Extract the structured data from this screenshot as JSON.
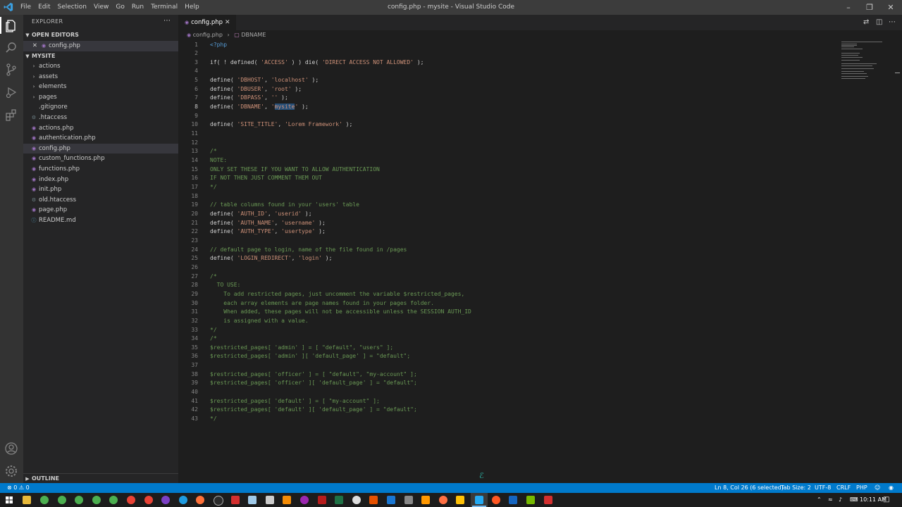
{
  "window": {
    "title": "config.php - mysite - Visual Studio Code",
    "menu": [
      "File",
      "Edit",
      "Selection",
      "View",
      "Go",
      "Run",
      "Terminal",
      "Help"
    ]
  },
  "sidebar": {
    "title": "EXPLORER",
    "open_editors_label": "OPEN EDITORS",
    "open_editors": [
      {
        "name": "config.php"
      }
    ],
    "folder_label": "MYSITE",
    "items": [
      {
        "name": "actions",
        "kind": "folder"
      },
      {
        "name": "assets",
        "kind": "folder"
      },
      {
        "name": "elements",
        "kind": "folder"
      },
      {
        "name": "pages",
        "kind": "folder"
      },
      {
        "name": ".gitignore",
        "kind": "file"
      },
      {
        "name": ".htaccess",
        "kind": "gear"
      },
      {
        "name": "actions.php",
        "kind": "php"
      },
      {
        "name": "authentication.php",
        "kind": "php"
      },
      {
        "name": "config.php",
        "kind": "php",
        "selected": true
      },
      {
        "name": "custom_functions.php",
        "kind": "php"
      },
      {
        "name": "functions.php",
        "kind": "php"
      },
      {
        "name": "index.php",
        "kind": "php"
      },
      {
        "name": "init.php",
        "kind": "php"
      },
      {
        "name": "old.htaccess",
        "kind": "gear"
      },
      {
        "name": "page.php",
        "kind": "php"
      },
      {
        "name": "README.md",
        "kind": "info"
      }
    ],
    "outline_label": "OUTLINE"
  },
  "editor": {
    "tab_label": "config.php",
    "breadcrumb": [
      "config.php",
      "DBNAME"
    ],
    "active_line": 8,
    "lines": [
      [
        [
          "<?php",
          "kw"
        ]
      ],
      [],
      [
        [
          "if( ! defined( ",
          "default"
        ],
        [
          "'ACCESS'",
          "str"
        ],
        [
          " ) ) die( ",
          "default"
        ],
        [
          "'DIRECT ACCESS NOT ALLOWED'",
          "str"
        ],
        [
          " );",
          "default"
        ]
      ],
      [],
      [
        [
          "define( ",
          "default"
        ],
        [
          "'DBHOST'",
          "str"
        ],
        [
          ", ",
          "default"
        ],
        [
          "'localhost'",
          "str"
        ],
        [
          " );",
          "default"
        ]
      ],
      [
        [
          "define( ",
          "default"
        ],
        [
          "'DBUSER'",
          "str"
        ],
        [
          ", ",
          "default"
        ],
        [
          "'root'",
          "str"
        ],
        [
          " );",
          "default"
        ]
      ],
      [
        [
          "define( ",
          "default"
        ],
        [
          "'DBPASS'",
          "str"
        ],
        [
          ", ",
          "default"
        ],
        [
          "''",
          "str"
        ],
        [
          " );",
          "default"
        ]
      ],
      [
        [
          "define( ",
          "default"
        ],
        [
          "'DBNAME'",
          "str"
        ],
        [
          ", ",
          "default"
        ],
        [
          "'",
          "str"
        ],
        [
          "mysite",
          "hl"
        ],
        [
          "'",
          "str"
        ],
        [
          " );",
          "default"
        ]
      ],
      [],
      [
        [
          "define( ",
          "default"
        ],
        [
          "'SITE_TITLE'",
          "str"
        ],
        [
          ", ",
          "default"
        ],
        [
          "'Lorem Framework'",
          "str"
        ],
        [
          " );",
          "default"
        ]
      ],
      [],
      [],
      [
        [
          "/*",
          "com"
        ]
      ],
      [
        [
          "NOTE:",
          "com"
        ]
      ],
      [
        [
          "ONLY SET THESE IF YOU WANT TO ALLOW AUTHENTICATION",
          "com"
        ]
      ],
      [
        [
          "IF NOT THEN JUST COMMENT THEM OUT",
          "com"
        ]
      ],
      [
        [
          "*/",
          "com"
        ]
      ],
      [],
      [
        [
          "// table columns found in your 'users' table",
          "com"
        ]
      ],
      [
        [
          "define( ",
          "default"
        ],
        [
          "'AUTH_ID'",
          "str"
        ],
        [
          ", ",
          "default"
        ],
        [
          "'userid'",
          "str"
        ],
        [
          " );",
          "default"
        ]
      ],
      [
        [
          "define( ",
          "default"
        ],
        [
          "'AUTH_NAME'",
          "str"
        ],
        [
          ", ",
          "default"
        ],
        [
          "'username'",
          "str"
        ],
        [
          " );",
          "default"
        ]
      ],
      [
        [
          "define( ",
          "default"
        ],
        [
          "'AUTH_TYPE'",
          "str"
        ],
        [
          ", ",
          "default"
        ],
        [
          "'usertype'",
          "str"
        ],
        [
          " );",
          "default"
        ]
      ],
      [],
      [
        [
          "// default page to login, name of the file found in /pages",
          "com"
        ]
      ],
      [
        [
          "define( ",
          "default"
        ],
        [
          "'LOGIN_REDIRECT'",
          "str"
        ],
        [
          ", ",
          "default"
        ],
        [
          "'login'",
          "str"
        ],
        [
          " );",
          "default"
        ]
      ],
      [],
      [
        [
          "/*",
          "com"
        ]
      ],
      [
        [
          "  TO USE:",
          "com"
        ]
      ],
      [
        [
          "    To add restricted pages, just uncomment the variable $restricted_pages,",
          "com"
        ]
      ],
      [
        [
          "    each array elements are page names found in your pages folder.",
          "com"
        ]
      ],
      [
        [
          "    When added, these pages will not be accessible unless the SESSION AUTH_ID",
          "com"
        ]
      ],
      [
        [
          "    is assigned with a value.",
          "com"
        ]
      ],
      [
        [
          "*/",
          "com"
        ]
      ],
      [
        [
          "/*",
          "com"
        ]
      ],
      [
        [
          "$restricted_pages[ 'admin' ] = [ \"default\", \"users\" ];",
          "com"
        ]
      ],
      [
        [
          "$restricted_pages[ 'admin' ][ 'default_page' ] = \"default\";",
          "com"
        ]
      ],
      [],
      [
        [
          "$restricted_pages[ 'officer' ] = [ \"default\", \"my-account\" ];",
          "com"
        ]
      ],
      [
        [
          "$restricted_pages[ 'officer' ][ 'default_page' ] = \"default\";",
          "com"
        ]
      ],
      [],
      [
        [
          "$restricted_pages[ 'default' ] = [ \"my-account\" ];",
          "com"
        ]
      ],
      [
        [
          "$restricted_pages[ 'default' ][ 'default_page' ] = \"default\";",
          "com"
        ]
      ],
      [
        [
          "*/",
          "com"
        ]
      ]
    ]
  },
  "statusbar": {
    "problems": "⊗ 0 ⚠ 0",
    "position": "Ln 8, Col 26 (6 selected)",
    "tab_size": "Tab Size: 2",
    "encoding": "UTF-8",
    "eol": "CRLF",
    "language": "PHP"
  },
  "taskbar": {
    "clock": "10:11 AM"
  },
  "colors": {
    "accent": "#007acc",
    "titlebar": "#3c3c3c",
    "sidebar": "#252526",
    "editor": "#1e1e1e"
  }
}
